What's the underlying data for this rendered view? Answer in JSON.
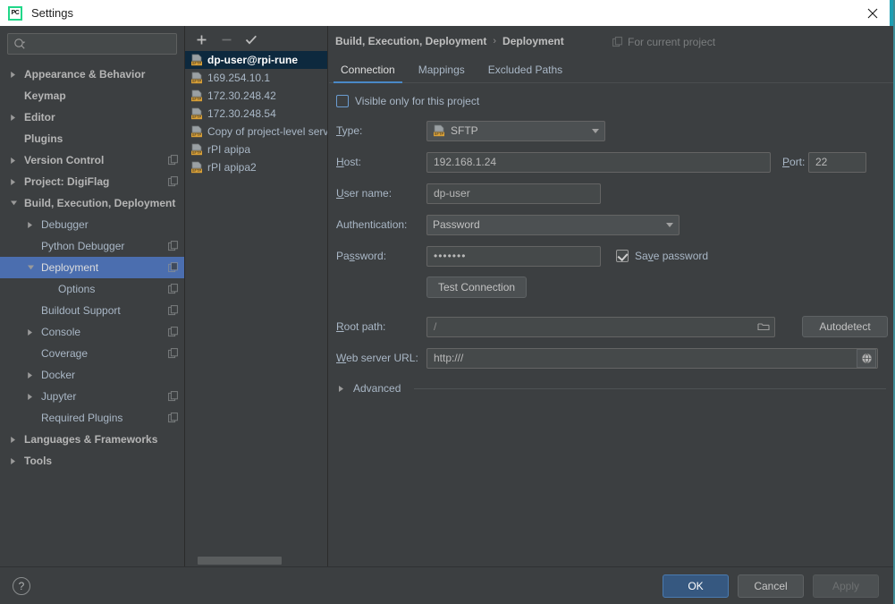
{
  "window": {
    "title": "Settings",
    "logo_text": "PC",
    "close_icon": "close-icon",
    "accent_color": "#1f9fb3"
  },
  "search": {
    "placeholder": "",
    "value": "",
    "icon": "search-icon"
  },
  "sidebar": {
    "items": [
      {
        "label": "Appearance & Behavior",
        "indent": 0,
        "twisty": "right",
        "bold": true,
        "badge": false,
        "selected": false
      },
      {
        "label": "Keymap",
        "indent": 0,
        "twisty": "none",
        "bold": true,
        "badge": false,
        "selected": false
      },
      {
        "label": "Editor",
        "indent": 0,
        "twisty": "right",
        "bold": true,
        "badge": false,
        "selected": false
      },
      {
        "label": "Plugins",
        "indent": 0,
        "twisty": "none",
        "bold": true,
        "badge": false,
        "selected": false
      },
      {
        "label": "Version Control",
        "indent": 0,
        "twisty": "right",
        "bold": true,
        "badge": true,
        "selected": false
      },
      {
        "label": "Project: DigiFlag",
        "indent": 0,
        "twisty": "right",
        "bold": true,
        "badge": true,
        "selected": false
      },
      {
        "label": "Build, Execution, Deployment",
        "indent": 0,
        "twisty": "down",
        "bold": true,
        "badge": false,
        "selected": false
      },
      {
        "label": "Debugger",
        "indent": 1,
        "twisty": "right",
        "bold": false,
        "badge": false,
        "selected": false
      },
      {
        "label": "Python Debugger",
        "indent": 1,
        "twisty": "none",
        "bold": false,
        "badge": true,
        "selected": false
      },
      {
        "label": "Deployment",
        "indent": 1,
        "twisty": "down",
        "bold": false,
        "badge": true,
        "selected": true
      },
      {
        "label": "Options",
        "indent": 2,
        "twisty": "none",
        "bold": false,
        "badge": true,
        "selected": false
      },
      {
        "label": "Buildout Support",
        "indent": 1,
        "twisty": "none",
        "bold": false,
        "badge": true,
        "selected": false
      },
      {
        "label": "Console",
        "indent": 1,
        "twisty": "right",
        "bold": false,
        "badge": true,
        "selected": false
      },
      {
        "label": "Coverage",
        "indent": 1,
        "twisty": "none",
        "bold": false,
        "badge": true,
        "selected": false
      },
      {
        "label": "Docker",
        "indent": 1,
        "twisty": "right",
        "bold": false,
        "badge": false,
        "selected": false
      },
      {
        "label": "Jupyter",
        "indent": 1,
        "twisty": "right",
        "bold": false,
        "badge": true,
        "selected": false
      },
      {
        "label": "Required Plugins",
        "indent": 1,
        "twisty": "none",
        "bold": false,
        "badge": true,
        "selected": false
      },
      {
        "label": "Languages & Frameworks",
        "indent": 0,
        "twisty": "right",
        "bold": true,
        "badge": false,
        "selected": false
      },
      {
        "label": "Tools",
        "indent": 0,
        "twisty": "right",
        "bold": true,
        "badge": false,
        "selected": false
      }
    ]
  },
  "server_list": {
    "toolbar": {
      "add_label": "+",
      "remove_label": "−",
      "default_icon": "checkmark-icon"
    },
    "items": [
      {
        "label": "dp-user@rpi-rune",
        "selected": true
      },
      {
        "label": "169.254.10.1",
        "selected": false
      },
      {
        "label": "172.30.248.42",
        "selected": false
      },
      {
        "label": "172.30.248.54",
        "selected": false
      },
      {
        "label": "Copy of project-level server",
        "selected": false
      },
      {
        "label": "rPI apipa",
        "selected": false
      },
      {
        "label": "rPI apipa2",
        "selected": false
      }
    ]
  },
  "header": {
    "breadcrumb_root": "Build, Execution, Deployment",
    "breadcrumb_sep": "›",
    "breadcrumb_current": "Deployment",
    "scope_label": "For current project",
    "scope_icon": "copy-badge-icon"
  },
  "tabs": [
    {
      "label": "Connection",
      "active": true
    },
    {
      "label": "Mappings",
      "active": false
    },
    {
      "label": "Excluded Paths",
      "active": false
    }
  ],
  "form": {
    "visible_only_label": "Visible only for this project",
    "visible_only_checked": false,
    "type_label": "Type:",
    "type_value": "SFTP",
    "type_icon": "sftp-icon",
    "host_label": "Host:",
    "host_value": "192.168.1.24",
    "port_label": "Port:",
    "port_value": "22",
    "username_label": "User name:",
    "username_value": "dp-user",
    "auth_label": "Authentication:",
    "auth_value": "Password",
    "password_label": "Password:",
    "password_value": "•••••••",
    "save_password_label": "Save password",
    "save_password_checked": true,
    "test_connection_label": "Test Connection",
    "root_path_label": "Root path:",
    "root_path_value": "/",
    "root_path_browse_icon": "folder-icon",
    "autodetect_label": "Autodetect",
    "web_url_label": "Web server URL:",
    "web_url_value": "http:///",
    "web_url_icon": "globe-icon",
    "advanced_label": "Advanced",
    "advanced_expanded": false
  },
  "bottom": {
    "help_label": "?",
    "ok_label": "OK",
    "cancel_label": "Cancel",
    "apply_label": "Apply",
    "apply_disabled": true
  }
}
